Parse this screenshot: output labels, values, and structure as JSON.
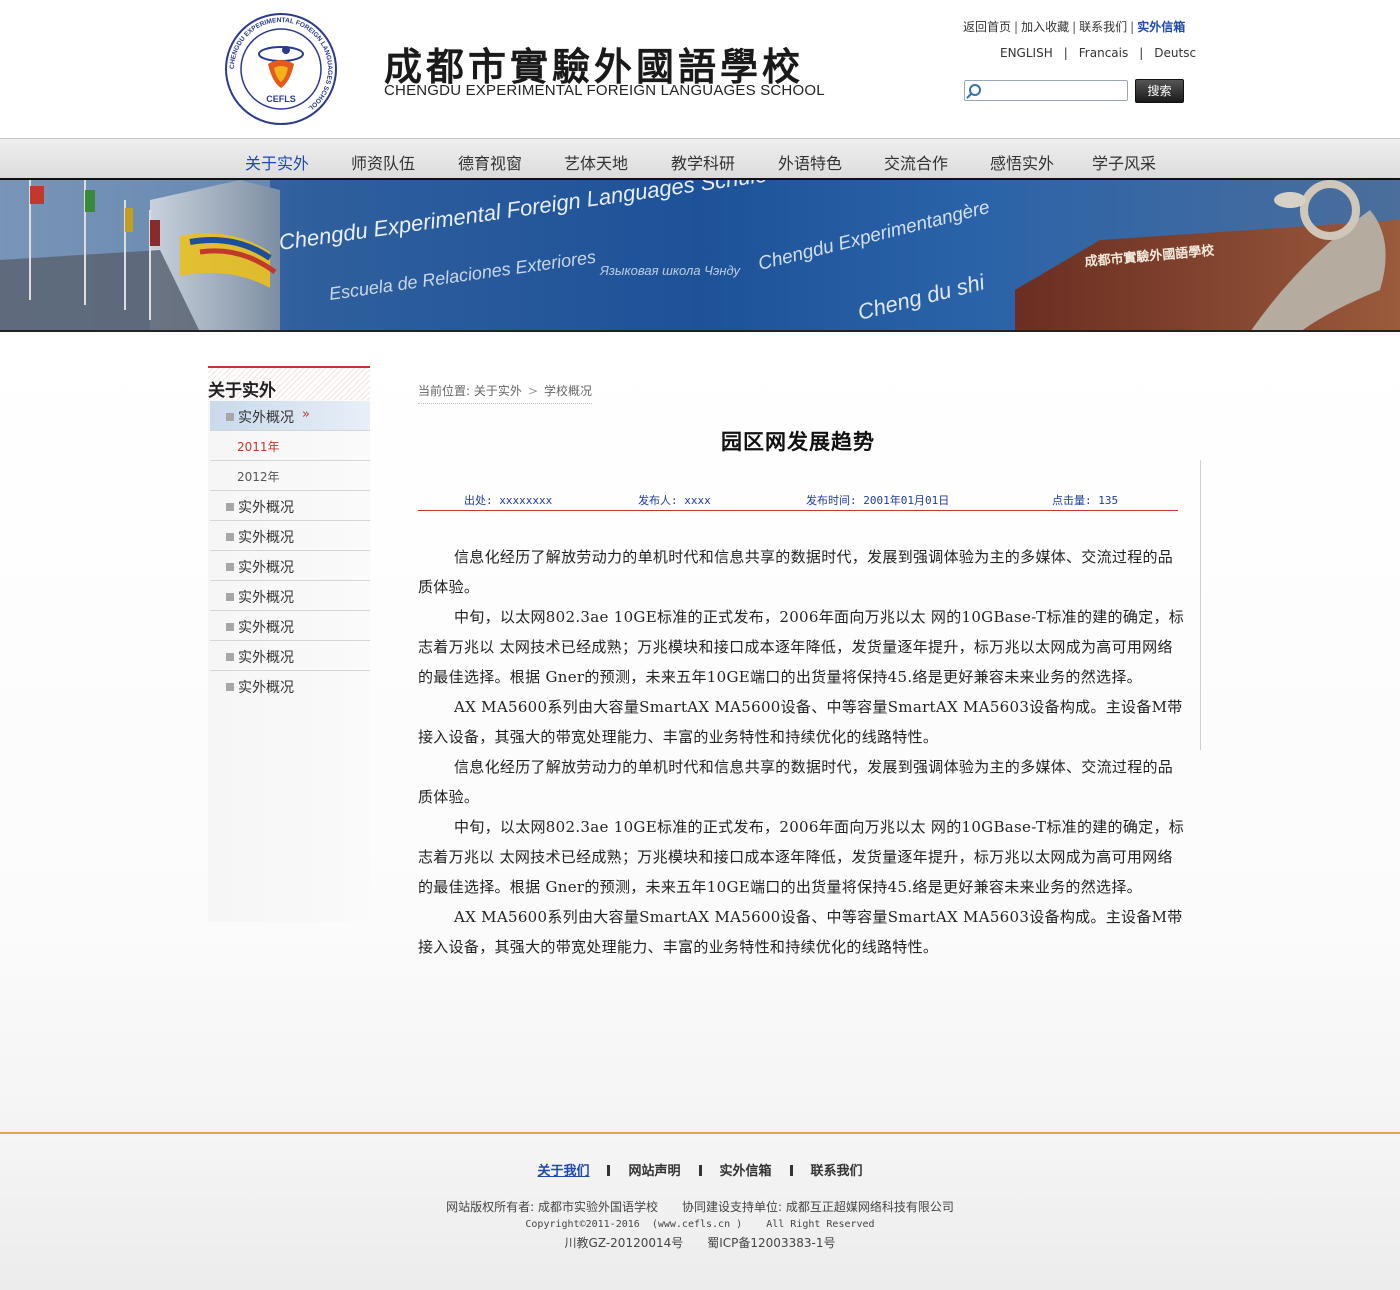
{
  "header": {
    "logo_text": "CEFLS",
    "logo_ring_text": "CHENGDU EXPERIMENTAL FOREIGN LANGUAGES SCHOOL",
    "school_name_cn": "成都市實驗外國語學校",
    "school_name_en": "CHENGDU EXPERIMENTAL FOREIGN LANGUAGES SCHOOL",
    "top_links": [
      "返回首页",
      "加入收藏",
      "联系我们",
      "实外信箱"
    ],
    "top_sep": "|",
    "languages": [
      "ENGLISH",
      "Francais",
      "Deutsc"
    ],
    "lang_sep": "|",
    "search": {
      "placeholder": "",
      "button": "搜索"
    }
  },
  "nav": {
    "items": [
      "关于实外",
      "师资队伍",
      "德育视窗",
      "艺体天地",
      "教学科研",
      "外语特色",
      "交流合作",
      "感悟实外",
      "学子风采"
    ],
    "active_index": 0
  },
  "banner": {
    "texts": [
      "Chengdu Experimental Foreign Languages Schule",
      "Escuela de Relaciones Exteriores",
      "Chengdu Experimentangère",
      "Cheng du shi",
      "Языковая школа Чэнду"
    ],
    "sign_text": "成都市實驗外國語學校"
  },
  "sidebar": {
    "title": "关于实外",
    "current": "实外概况",
    "current_arrow": "»",
    "sub_items": [
      "2011年",
      "2012年"
    ],
    "items": [
      "实外概况",
      "实外概况",
      "实外概况",
      "实外概况",
      "实外概况",
      "实外概况",
      "实外概况"
    ]
  },
  "breadcrumb": {
    "prefix": "当前位置:",
    "items": [
      "关于实外",
      "学校概况"
    ],
    "sep": ">"
  },
  "article": {
    "title": "园区网发展趋势",
    "meta": {
      "source": "出处: xxxxxxxx",
      "author": "发布人: xxxx",
      "date": "发布时间: 2001年01月01日",
      "hits": "点击量: 135"
    },
    "paragraphs": [
      "信息化经历了解放劳动力的单机时代和信息共享的数据时代，发展到强调体验为主的多媒体、交流过程的品质体验。",
      "中旬，以太网802.3ae 10GE标准的正式发布，2006年面向万兆以太 网的10GBase-T标准的建的确定，标志着万兆以 太网技术已经成熟；万兆模块和接口成本逐年降低，发货量逐年提升，标万兆以太网成为高可用网络的最佳选择。根据 Gner的预测，未来五年10GE端口的出货量将保持45.络是更好兼容未来业务的然选择。",
      " AX MA5600系列由大容量SmartAX MA5600设备、中等容量SmartAX MA5603设备构成。主设备M带接入设备，其强大的带宽处理能力、丰富的业务特性和持续优化的线路特性。",
      "信息化经历了解放劳动力的单机时代和信息共享的数据时代，发展到强调体验为主的多媒体、交流过程的品质体验。",
      "中旬，以太网802.3ae 10GE标准的正式发布，2006年面向万兆以太 网的10GBase-T标准的建的确定，标志着万兆以 太网技术已经成熟；万兆模块和接口成本逐年降低，发货量逐年提升，标万兆以太网成为高可用网络的最佳选择。根据 Gner的预测，未来五年10GE端口的出货量将保持45.络是更好兼容未来业务的然选择。",
      " AX MA5600系列由大容量SmartAX MA5600设备、中等容量SmartAX MA5603设备构成。主设备M带接入设备，其强大的带宽处理能力、丰富的业务特性和持续优化的线路特性。"
    ]
  },
  "footer": {
    "links": [
      "关于我们",
      "网站声明",
      "实外信箱",
      "联系我们"
    ],
    "copyright_owner": "网站版权所有者: 成都市实验外国语学校",
    "support": "协同建设支持单位: 成都互正超媒网络科技有限公司",
    "copyright": "Copyright©2011-2016  (www.cefls.cn )    All Right Reserved",
    "icp_1": "川教GZ-20120014号",
    "icp_2": "蜀ICP备12003383-1号"
  },
  "colors": {
    "accent_blue": "#1f4aa8",
    "accent_red": "#c0392b",
    "footer_border": "#e8a04a"
  }
}
